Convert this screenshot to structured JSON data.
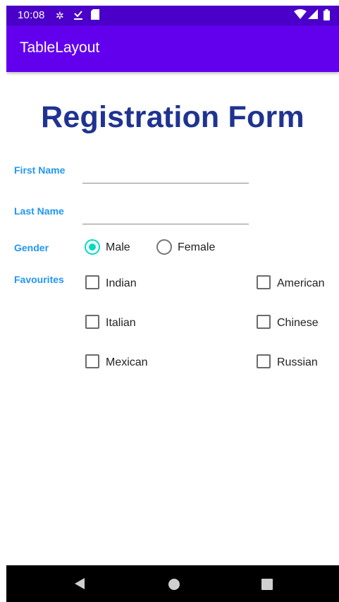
{
  "status_bar": {
    "time": "10:08",
    "icons": [
      "settings-icon",
      "download-done-icon",
      "sd-card-icon",
      "wifi-icon",
      "signal-icon",
      "battery-icon"
    ]
  },
  "app_bar": {
    "title": "TableLayout"
  },
  "form": {
    "title": "Registration Form",
    "first_name": {
      "label": "First Name",
      "value": ""
    },
    "last_name": {
      "label": "Last Name",
      "value": ""
    },
    "gender": {
      "label": "Gender",
      "options": [
        {
          "label": "Male",
          "checked": true
        },
        {
          "label": "Female",
          "checked": false
        }
      ]
    },
    "favourites": {
      "label": "Favourites",
      "options": [
        {
          "label": "Indian",
          "checked": false
        },
        {
          "label": "American",
          "checked": false
        },
        {
          "label": "Italian",
          "checked": false
        },
        {
          "label": "Chinese",
          "checked": false
        },
        {
          "label": "Mexican",
          "checked": false
        },
        {
          "label": "Russian",
          "checked": false
        }
      ]
    }
  },
  "colors": {
    "status_bar": "#4a00c8",
    "app_bar": "#6200ee",
    "title": "#1f3391",
    "label": "#2196f3",
    "radio_accent": "#03dac5"
  }
}
